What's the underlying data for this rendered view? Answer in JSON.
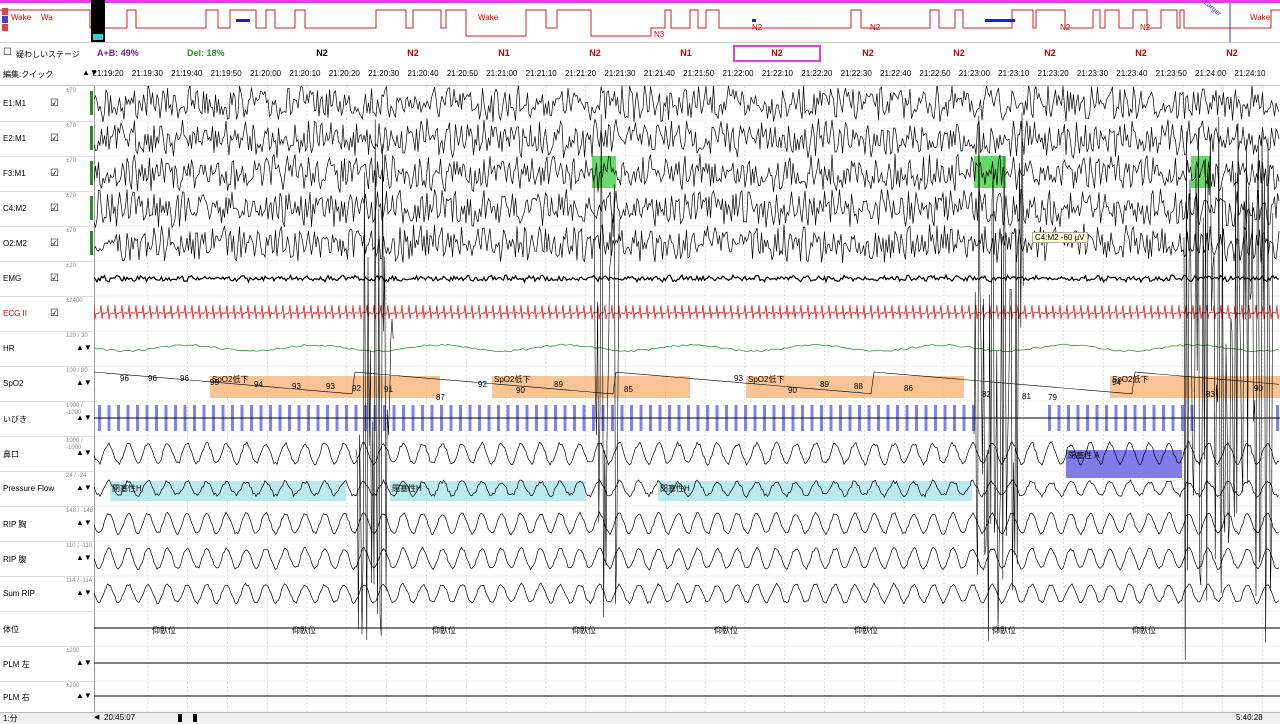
{
  "hypnogram": {
    "labels": [
      "Wake",
      "Wa",
      "Wake",
      "N3",
      "N2",
      "N2",
      "N2",
      "N2",
      "Wake"
    ],
    "tag": "Larger"
  },
  "stage_bar": {
    "uncertain_checkbox_label": "疑わしいステージ",
    "ab_label": "A+B: 49%",
    "del_label": "Del: 18%",
    "edit_label": "編集:クイック",
    "stages": [
      "N2",
      "N2",
      "N1",
      "N2",
      "N1",
      "N2",
      "N2",
      "N2",
      "N2",
      "N2",
      "N2"
    ],
    "selected_index": 5,
    "colors": {
      "ab": "#7a1f8c",
      "del": "#2e8b2e",
      "stage": "#cc0000",
      "stage_first": "#000000",
      "select": "#e040e0"
    }
  },
  "time_ticks": [
    "21:19:20",
    "21:19:30",
    "21:19:40",
    "21:19:50",
    "21:20:00",
    "21:20:10",
    "21:20:20",
    "21:20:30",
    "21:20:40",
    "21:20:50",
    "21:21:00",
    "21:21:10",
    "21:21:20",
    "21:21:30",
    "21:21:40",
    "21:21:50",
    "21:22:00",
    "21:22:10",
    "21:22:20",
    "21:22:30",
    "21:22:40",
    "21:22:50",
    "21:23:00",
    "21:23:10",
    "21:23:20",
    "21:23:30",
    "21:23:40",
    "21:23:50",
    "21:24:00",
    "21:24:10"
  ],
  "channels": [
    {
      "name": "E1:M1",
      "check": "☑",
      "scale": "±70"
    },
    {
      "name": "E2:M1",
      "check": "☑",
      "scale": "±70"
    },
    {
      "name": "F3:M1",
      "check": "☑",
      "scale": "±70"
    },
    {
      "name": "C4:M2",
      "check": "☑",
      "scale": "±70"
    },
    {
      "name": "O2:M2",
      "check": "☑",
      "scale": "±70"
    },
    {
      "name": "EMG",
      "check": "☑",
      "scale": "±20"
    },
    {
      "name": "ECG II",
      "check": "☑",
      "scale": "±2400"
    },
    {
      "name": "HR",
      "check": "▲▼",
      "scale": "120 / 30"
    },
    {
      "name": "SpO2",
      "check": "▲▼",
      "scale": "100 / 80"
    },
    {
      "name": "いびき",
      "check": "▲▼",
      "scale": "1000 / -1000"
    },
    {
      "name": "鼻口",
      "check": "▲▼",
      "scale": "1000 / -1000"
    },
    {
      "name": "Pressure Flow",
      "check": "▲▼",
      "scale": "24 / -24"
    },
    {
      "name": "RIP 胸",
      "check": "▲▼",
      "scale": "148 / -148"
    },
    {
      "name": "RIP 腹",
      "check": "▲▼",
      "scale": "110 / -110"
    },
    {
      "name": "Sum RIP",
      "check": "▲▼",
      "scale": "114 / -114"
    },
    {
      "name": "体位",
      "check": "",
      "scale": ""
    },
    {
      "name": "PLM 左",
      "check": "▲▼",
      "scale": "±200"
    },
    {
      "name": "PLM 右",
      "check": "▲▼",
      "scale": "±200"
    }
  ],
  "spo2_values": [
    "96",
    "96",
    "96",
    "95",
    "94",
    "93",
    "93",
    "92",
    "91",
    "87",
    "92",
    "90",
    "89",
    "85",
    "93",
    "90",
    "89",
    "88",
    "86",
    "82",
    "81",
    "79",
    "94",
    "83",
    "90"
  ],
  "spo2_events": [
    "SpO2低下",
    "SpO2低下",
    "SpO2低下",
    "SpO2低下"
  ],
  "flow_events": [
    "閉塞性H",
    "閉塞性H",
    "閉塞性H"
  ],
  "apnea_event": "閉塞性 A",
  "position_labels": [
    "仰臥位",
    "仰臥位",
    "仰臥位",
    "仰臥位",
    "仰臥位",
    "仰臥位",
    "仰臥位",
    "仰臥位"
  ],
  "measure_tooltip": "C4:M2 -60 µV",
  "footer": {
    "left": "1:分",
    "start": "20:45:07",
    "end": "5:40:28"
  }
}
